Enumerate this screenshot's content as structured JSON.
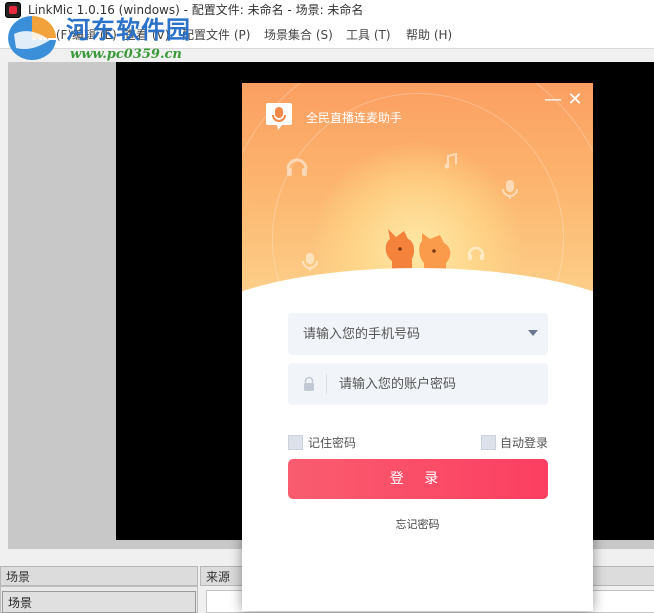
{
  "window": {
    "title": "LinkMic 1.0.16 (windows) - 配置文件: 未命名 - 场景: 未命名"
  },
  "menubar": {
    "items": [
      "文件 (F)",
      "编辑 (E)",
      "查看 (V)",
      "配置文件 (P)",
      "场景集合 (S)",
      "工具 (T)",
      "帮助 (H)"
    ]
  },
  "watermark": {
    "title": "河东软件园",
    "url": "www.pc0359.cn"
  },
  "docks": {
    "scenes_label": "场景",
    "sources_label": "来源",
    "scene_item": "场景"
  },
  "login": {
    "app_name": "全民直播连麦助手",
    "phone_placeholder": "请输入您的手机号码",
    "password_placeholder": "请输入您的账户密码",
    "remember_label": "记住密码",
    "auto_login_label": "自动登录",
    "login_button": "登 录",
    "forgot_link": "忘记密码",
    "minimize_glyph": "—",
    "close_glyph": "✕"
  },
  "colors": {
    "banner_top": "#fb9f62",
    "banner_bottom": "#fdd08a",
    "login_button": "#fc4a66",
    "field_bg": "#f1f4f8"
  },
  "icons": {
    "app": "linkmic-app-icon",
    "logo": "microphone-bubble-icon",
    "lock": "lock-icon",
    "dropdown": "chevron-down-icon"
  }
}
